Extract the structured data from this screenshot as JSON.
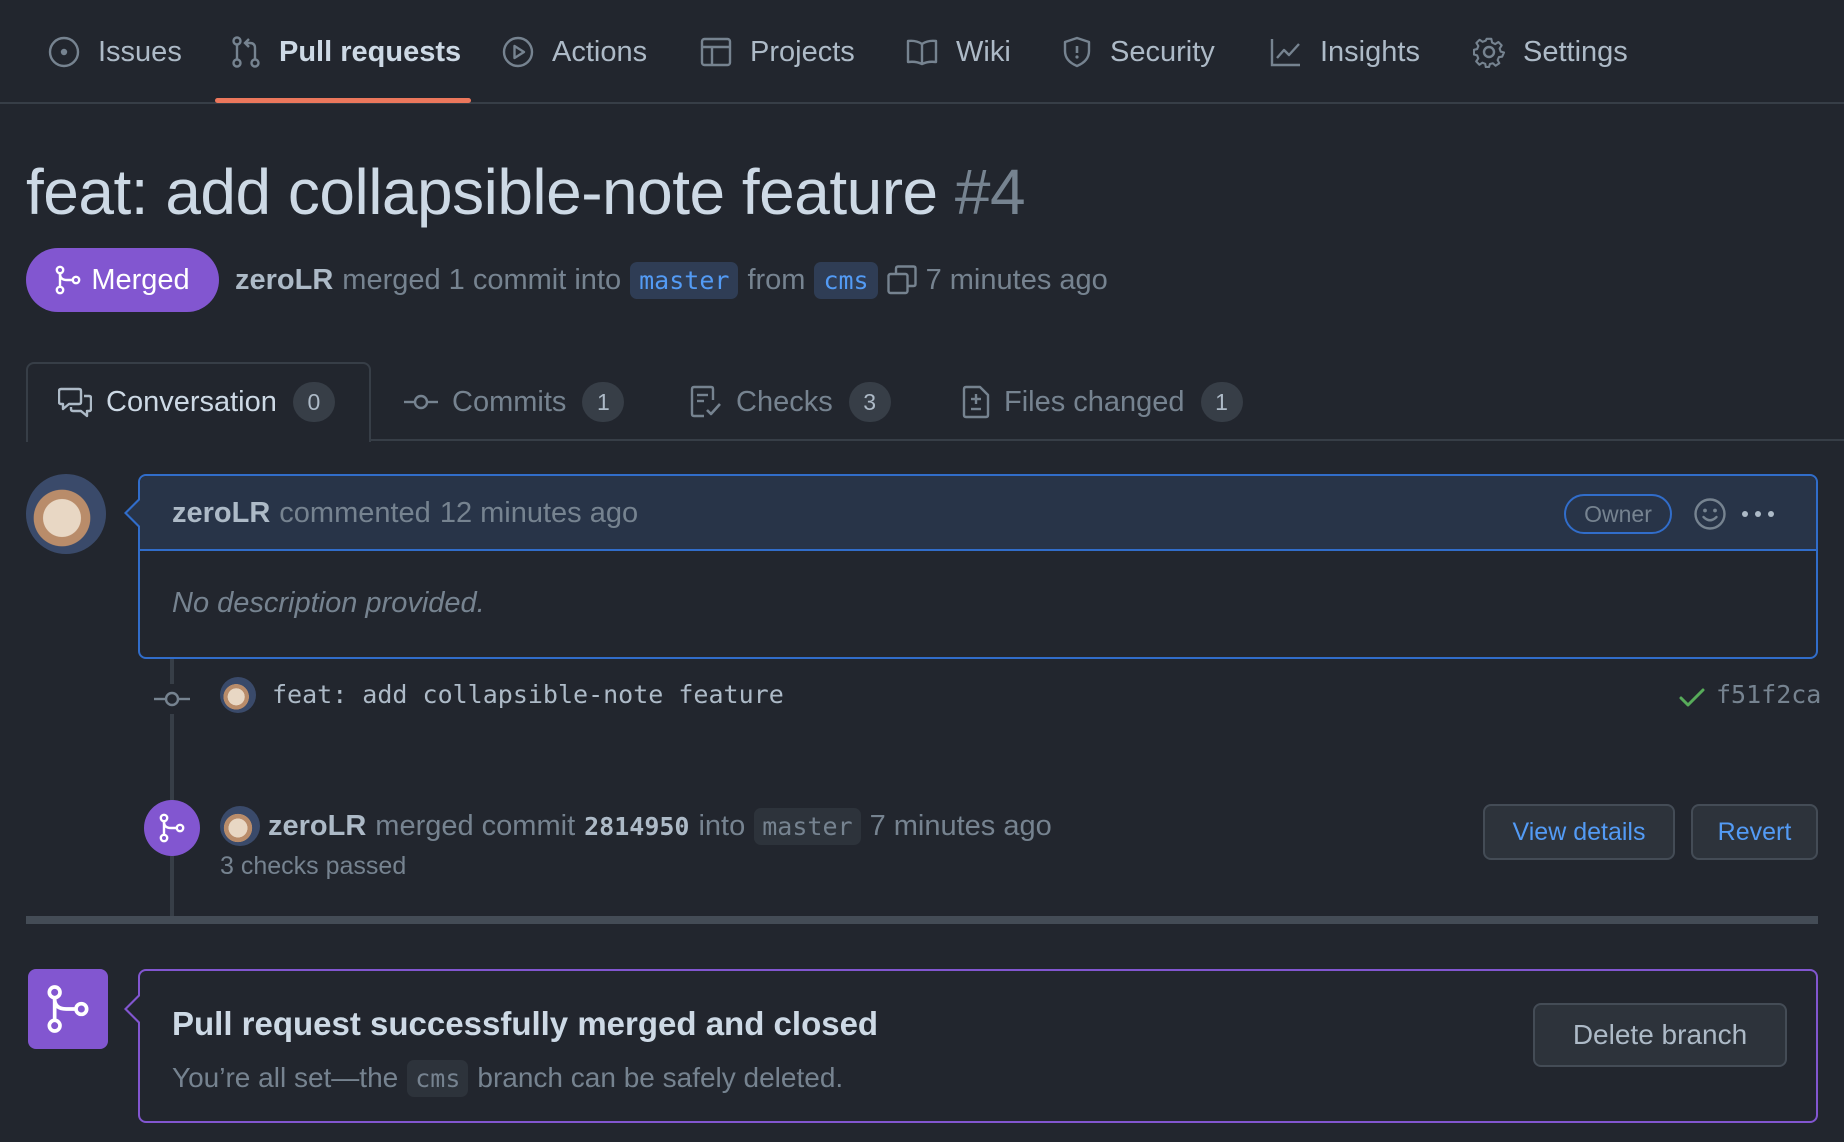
{
  "nav": {
    "items": [
      {
        "label": "Issues",
        "icon": "issue-opened-icon"
      },
      {
        "label": "Pull requests",
        "icon": "git-pull-request-icon",
        "selected": true
      },
      {
        "label": "Actions",
        "icon": "play-icon"
      },
      {
        "label": "Projects",
        "icon": "table-icon"
      },
      {
        "label": "Wiki",
        "icon": "book-icon"
      },
      {
        "label": "Security",
        "icon": "shield-icon"
      },
      {
        "label": "Insights",
        "icon": "graph-icon"
      },
      {
        "label": "Settings",
        "icon": "gear-icon"
      }
    ],
    "selected_underline_color": "#ec775c"
  },
  "pr": {
    "title": "feat: add collapsible-note feature",
    "number": "#4",
    "state": "Merged",
    "state_color": "#8256d0",
    "author": "zeroLR",
    "merged_text": "merged 1 commit into",
    "base_branch": "master",
    "from_text": "from",
    "head_branch": "cms",
    "time": "7 minutes ago"
  },
  "tabs": [
    {
      "label": "Conversation",
      "count": "0",
      "icon": "comment-discussion-icon",
      "active": true
    },
    {
      "label": "Commits",
      "count": "1",
      "icon": "git-commit-icon"
    },
    {
      "label": "Checks",
      "count": "3",
      "icon": "checklist-icon"
    },
    {
      "label": "Files changed",
      "count": "1",
      "icon": "file-diff-icon"
    }
  ],
  "comment": {
    "author": "zeroLR",
    "action": "commented",
    "time": "12 minutes ago",
    "role_label": "Owner",
    "body": "No description provided."
  },
  "commit": {
    "message": "feat: add collapsible-note feature",
    "sha": "f51f2ca",
    "status": "check-icon"
  },
  "merge_event": {
    "author": "zeroLR",
    "action": "merged commit",
    "sha": "2814950",
    "into_text": "into",
    "branch": "master",
    "time": "7 minutes ago",
    "checks": "3 checks passed",
    "view_details_label": "View details",
    "revert_label": "Revert"
  },
  "merge_box": {
    "title": "Pull request successfully merged and closed",
    "sub_before": "You’re all set—the",
    "branch": "cms",
    "sub_after": "branch can be safely deleted.",
    "delete_label": "Delete branch"
  }
}
